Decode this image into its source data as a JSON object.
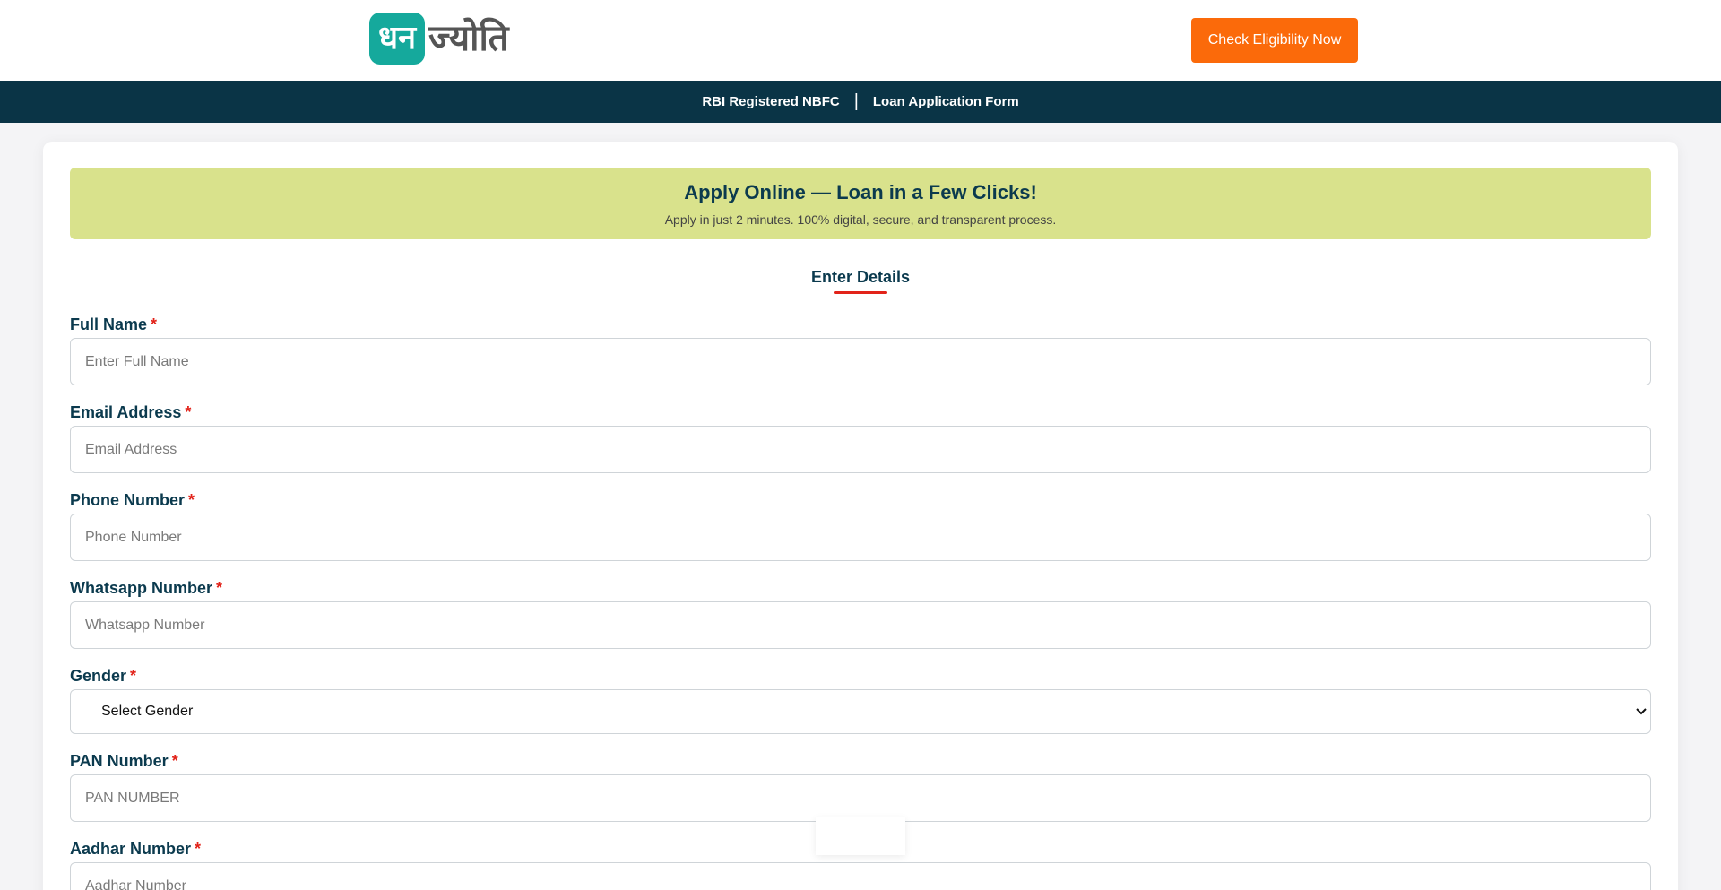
{
  "header": {
    "logo_badge": "धन",
    "logo_text": "ज्योति",
    "cta_label": "Check Eligibility Now",
    "accent_color": "#fb6a0a"
  },
  "subbar": {
    "item1": "RBI Registered NBFC",
    "separator": "|",
    "item2": "Loan Application Form"
  },
  "banner": {
    "title": "Apply Online — Loan in a Few Clicks!",
    "subtitle": "Apply in just 2 minutes. 100% digital, secure, and transparent process."
  },
  "form": {
    "section_title": "Enter Details",
    "required_mark": "*",
    "fields": [
      {
        "label": "Full Name",
        "placeholder": "Enter Full Name"
      },
      {
        "label": "Email Address",
        "placeholder": "Email Address"
      },
      {
        "label": "Phone Number",
        "placeholder": "Phone Number"
      },
      {
        "label": "Whatsapp Number",
        "placeholder": "Whatsapp Number"
      },
      {
        "label": "Gender",
        "selected": "Select Gender"
      },
      {
        "label": "PAN Number",
        "placeholder": "PAN NUMBER"
      },
      {
        "label": "Aadhar Number",
        "placeholder": "Aadhar Number"
      }
    ]
  },
  "icons": {
    "select_chevron": "chevron-down-icon"
  }
}
